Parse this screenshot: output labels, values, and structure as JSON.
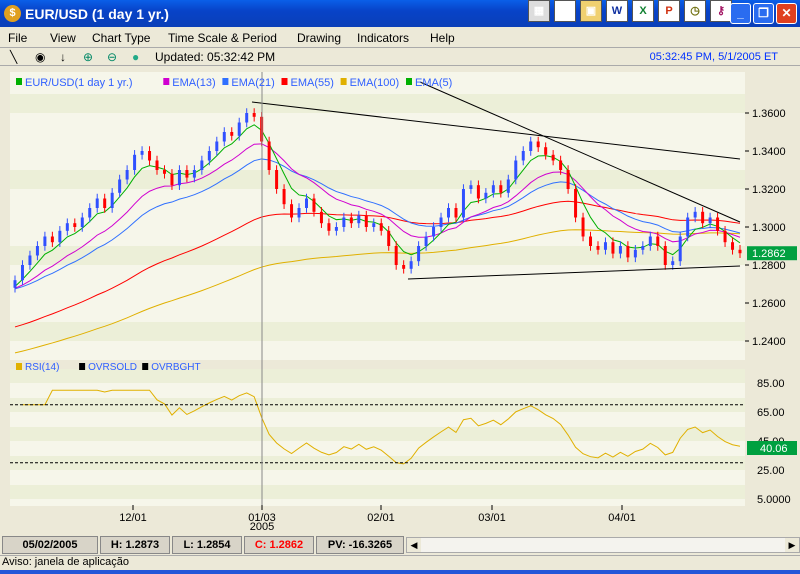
{
  "window": {
    "title": "EUR/USD (1 day  1 yr.)",
    "app_icon": "app-logo-icon",
    "tray_icons": [
      "windows-flag-icon",
      "notepad-icon",
      "folder-icon",
      "word-icon",
      "excel-icon",
      "powerpoint-icon",
      "clock-icon",
      "key-icon"
    ]
  },
  "menu": [
    "File",
    "View",
    "Chart Type",
    "Time Scale & Period",
    "Drawing",
    "Indicators",
    "Help"
  ],
  "toolbar": {
    "tools": [
      "line-draw-icon",
      "target-icon",
      "arrow-down-icon",
      "zoom-in-icon",
      "zoom-out-icon",
      "dot-icon"
    ],
    "updated": "Updated: 05:32:42 PM",
    "clock": "05:32:45 PM, 5/1/2005 ET"
  },
  "legend": [
    {
      "label": "EUR/USD(1 day  1 yr.)",
      "color": "#00b000"
    },
    {
      "label": "EMA(13)",
      "color": "#d000d0"
    },
    {
      "label": "EMA(21)",
      "color": "#3070ff"
    },
    {
      "label": "EMA(55)",
      "color": "#ff0000"
    },
    {
      "label": "EMA(100)",
      "color": "#e0b000"
    },
    {
      "label": "EMA(5)",
      "color": "#00b000"
    }
  ],
  "rsi_legend": [
    {
      "label": "RSI(14)",
      "color": "#e0b000"
    },
    {
      "label": "OVRSOLD",
      "color": "#000000"
    },
    {
      "label": "OVRBGHT",
      "color": "#000000"
    }
  ],
  "chart_data": {
    "type": "candlestick",
    "price_axis": {
      "ticks": [
        "1.3600",
        "1.3400",
        "1.3200",
        "1.3000",
        "1.2800",
        "1.2600",
        "1.2400"
      ],
      "range": [
        1.232,
        1.368
      ]
    },
    "last_price": "1.2862",
    "rsi_axis": {
      "ticks": [
        "85.00",
        "65.00",
        "45.00",
        "25.00",
        "5.0000"
      ],
      "range": [
        0,
        95
      ],
      "oversold": 30,
      "overbought": 70
    },
    "rsi_last": "40.06",
    "x_ticks": [
      {
        "label": "12/01",
        "sub": ""
      },
      {
        "label": "01/03",
        "sub": "2005"
      },
      {
        "label": "02/01",
        "sub": ""
      },
      {
        "label": "03/01",
        "sub": ""
      },
      {
        "label": "04/01",
        "sub": ""
      }
    ],
    "closes": [
      1.272,
      1.28,
      1.285,
      1.29,
      1.295,
      1.292,
      1.298,
      1.302,
      1.3,
      1.305,
      1.31,
      1.315,
      1.31,
      1.318,
      1.325,
      1.33,
      1.338,
      1.34,
      1.335,
      1.33,
      1.328,
      1.322,
      1.33,
      1.326,
      1.33,
      1.335,
      1.34,
      1.345,
      1.35,
      1.348,
      1.355,
      1.36,
      1.358,
      1.345,
      1.33,
      1.32,
      1.312,
      1.305,
      1.31,
      1.315,
      1.308,
      1.302,
      1.298,
      1.3,
      1.305,
      1.302,
      1.306,
      1.3,
      1.302,
      1.298,
      1.29,
      1.28,
      1.278,
      1.282,
      1.29,
      1.295,
      1.3,
      1.305,
      1.31,
      1.305,
      1.32,
      1.322,
      1.315,
      1.318,
      1.322,
      1.318,
      1.325,
      1.335,
      1.34,
      1.345,
      1.342,
      1.338,
      1.335,
      1.33,
      1.32,
      1.305,
      1.295,
      1.29,
      1.288,
      1.292,
      1.286,
      1.29,
      1.284,
      1.288,
      1.29,
      1.295,
      1.29,
      1.28,
      1.282,
      1.295,
      1.305,
      1.308,
      1.302,
      1.305,
      1.298,
      1.292,
      1.288,
      1.2862
    ]
  },
  "status": {
    "date": "05/02/2005",
    "high": "H: 1.2873",
    "low": "L: 1.2854",
    "close": "C: 1.2862",
    "pv": "PV: -16.3265",
    "close_color": "#ff0000"
  },
  "notice": "Aviso: janela de aplicação"
}
